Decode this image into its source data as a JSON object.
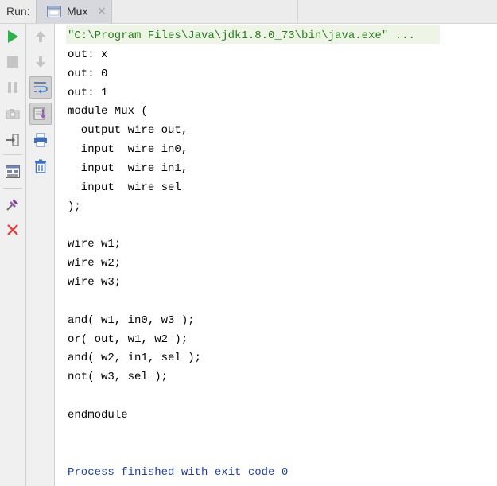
{
  "header": {
    "run_label": "Run:",
    "tab_label": "Mux",
    "tab_close": "×"
  },
  "toolbar": {
    "icons": [
      "run-icon",
      "stop-icon",
      "pause-icon",
      "camera-icon",
      "login-icon",
      "layout-icon",
      "pin-icon",
      "close-icon",
      "up-arrow-icon",
      "down-arrow-icon",
      "soft-wrap-icon",
      "scroll-to-end-icon",
      "print-icon",
      "trash-icon"
    ]
  },
  "colors": {
    "command": "#287c1f",
    "finish": "#1f3fa8",
    "run_green": "#2bb24c",
    "close_red": "#e0413a"
  },
  "console": {
    "lines": [
      "\"C:\\Program Files\\Java\\jdk1.8.0_73\\bin\\java.exe\" ...",
      "out: x",
      "out: 0",
      "out: 1",
      "module Mux (",
      "  output wire out,",
      "  input  wire in0,",
      "  input  wire in1,",
      "  input  wire sel",
      ");",
      "",
      "wire w1;",
      "wire w2;",
      "wire w3;",
      "",
      "and( w1, in0, w3 );",
      "or( out, w1, w2 );",
      "and( w2, in1, sel );",
      "not( w3, sel );",
      "",
      "endmodule",
      "",
      "",
      "Process finished with exit code 0"
    ]
  }
}
